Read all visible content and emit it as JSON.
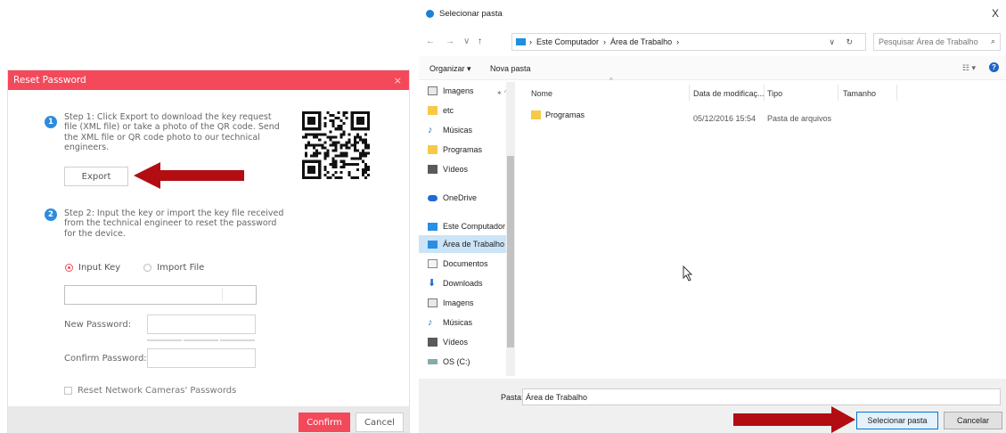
{
  "reset_dialog": {
    "title": "Reset Password",
    "close": "×",
    "step1": {
      "number": "1",
      "text": "Step 1: Click Export to download the key request file (XML file) or take a photo of the QR code. Send the XML file or QR code photo to our technical engineers."
    },
    "export_label": "Export",
    "step2": {
      "number": "2",
      "text": "Step 2: Input the key or import the key file received from the technical engineer to reset the password for the device."
    },
    "input_key_label": "Input Key",
    "import_file_label": "Import File",
    "new_password_label": "New Password:",
    "confirm_password_label": "Confirm Password:",
    "reset_cameras_label": "Reset Network Cameras' Passwords",
    "confirm_label": "Confirm",
    "cancel_label": "Cancel",
    "accent_color": "#f4495a"
  },
  "folder_dialog": {
    "title": "Selecionar pasta",
    "close": "X",
    "nav": {
      "back": "←",
      "forward": "→",
      "recent": "∨",
      "up": "↑"
    },
    "breadcrumb": [
      "Este Computador",
      "Área de Trabalho"
    ],
    "address_dropdown": "∨",
    "refresh": "↻",
    "search_placeholder": "Pesquisar Área de Trabalho",
    "search_icon": "⌕",
    "toolbar": {
      "organize": "Organizar ▾",
      "new_folder": "Nova pasta",
      "view": "☷ ▾",
      "help": "?"
    },
    "nav_items": [
      {
        "label": "Imagens",
        "icon": "img"
      },
      {
        "label": "etc",
        "icon": "folder"
      },
      {
        "label": "Músicas",
        "icon": "music"
      },
      {
        "label": "Programas",
        "icon": "folder"
      },
      {
        "label": "Vídeos",
        "icon": "video"
      },
      {
        "label": "OneDrive",
        "icon": "cloud"
      },
      {
        "label": "Este Computador",
        "icon": "pc"
      },
      {
        "label": "Área de Trabalho",
        "icon": "pc"
      },
      {
        "label": "Documentos",
        "icon": "doc"
      },
      {
        "label": "Downloads",
        "icon": "dl"
      },
      {
        "label": "Imagens",
        "icon": "img"
      },
      {
        "label": "Músicas",
        "icon": "music"
      },
      {
        "label": "Vídeos",
        "icon": "video"
      },
      {
        "label": "OS (C:)",
        "icon": "drive"
      }
    ],
    "columns": [
      "Nome",
      "Data de modificaç...",
      "Tipo",
      "Tamanho"
    ],
    "files": [
      {
        "name": "Programas",
        "modified": "05/12/2016 15:54",
        "type": "Pasta de arquivos",
        "size": ""
      }
    ],
    "pasta_label": "Pasta:",
    "pasta_value": "Área de Trabalho",
    "select_label": "Selecionar pasta",
    "cancel_label": "Cancelar",
    "accent_color": "#0078d7"
  }
}
